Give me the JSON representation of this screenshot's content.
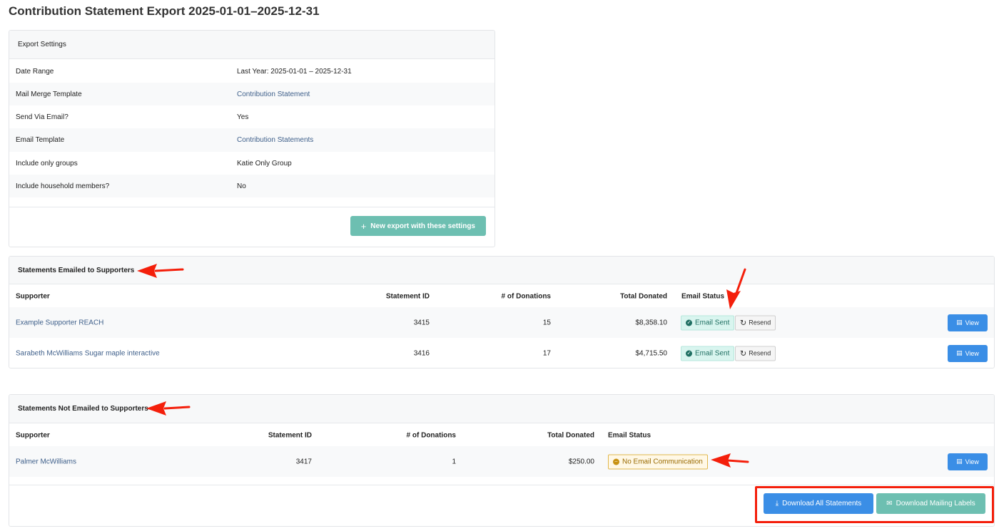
{
  "page": {
    "title": "Contribution Statement Export 2025-01-01–2025-12-31"
  },
  "settings": {
    "header": "Export Settings",
    "rows": [
      {
        "label": "Date Range",
        "value": "Last Year: 2025-01-01 – 2025-12-31",
        "is_link": false
      },
      {
        "label": "Mail Merge Template",
        "value": "Contribution Statement",
        "is_link": true
      },
      {
        "label": "Send Via Email?",
        "value": "Yes",
        "is_link": false
      },
      {
        "label": "Email Template",
        "value": "Contribution Statements",
        "is_link": true
      },
      {
        "label": "Include only groups",
        "value": "Katie Only Group",
        "is_link": false
      },
      {
        "label": "Include household members?",
        "value": "No",
        "is_link": false
      }
    ],
    "new_export_label": "New export with these settings"
  },
  "emailed": {
    "header": "Statements Emailed to Supporters",
    "columns": [
      "Supporter",
      "Statement ID",
      "# of Donations",
      "Total Donated",
      "Email Status"
    ],
    "rows": [
      {
        "supporter": "Example Supporter REACH",
        "statement_id": "3415",
        "donations": "15",
        "total": "$8,358.10",
        "status": "Email Sent",
        "resend": "Resend",
        "view": "View"
      },
      {
        "supporter": "Sarabeth McWilliams Sugar maple interactive",
        "statement_id": "3416",
        "donations": "17",
        "total": "$4,715.50",
        "status": "Email Sent",
        "resend": "Resend",
        "view": "View"
      }
    ]
  },
  "not_emailed": {
    "header": "Statements Not Emailed to Supporters",
    "columns": [
      "Supporter",
      "Statement ID",
      "# of Donations",
      "Total Donated",
      "Email Status"
    ],
    "rows": [
      {
        "supporter": "Palmer McWilliams",
        "statement_id": "3417",
        "donations": "1",
        "total": "$250.00",
        "status": "No Email Communication",
        "view": "View"
      }
    ],
    "download_all_label": "Download All Statements",
    "download_labels_label": "Download Mailing Labels"
  },
  "colors": {
    "accent_blue": "#3a8ee6",
    "accent_teal": "#6dbfb1",
    "annotation_red": "#f41f0b",
    "link": "#3e5f8a"
  }
}
